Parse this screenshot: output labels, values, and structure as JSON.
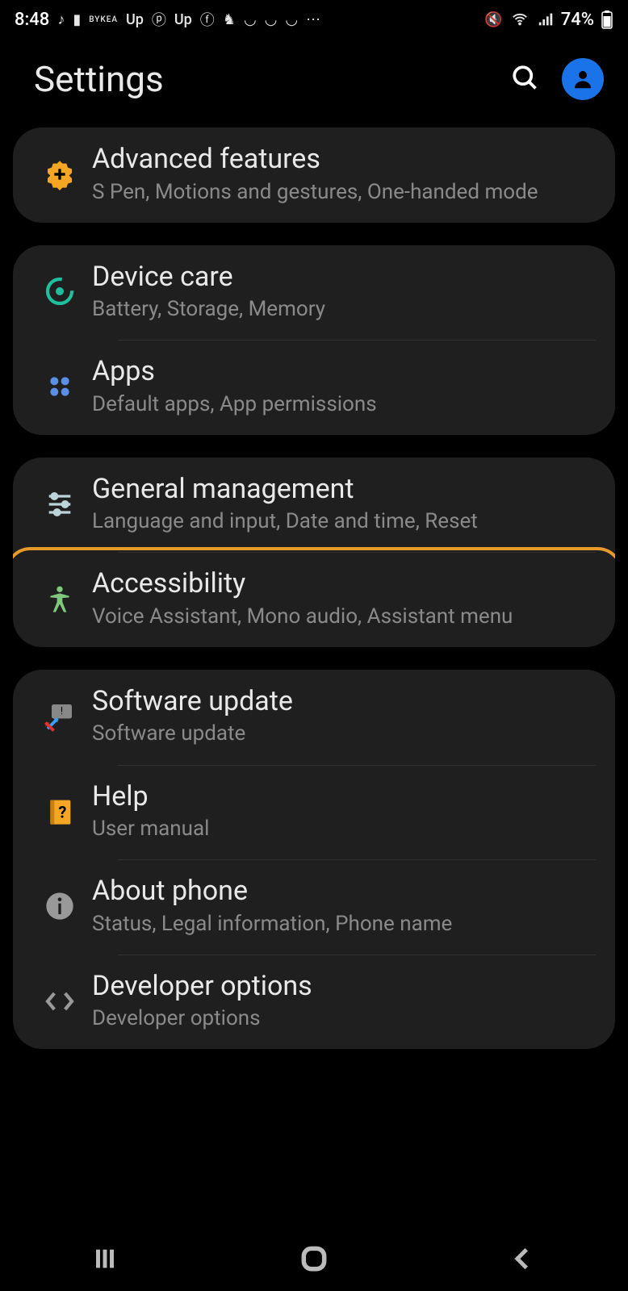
{
  "status_bar": {
    "time": "8:48",
    "battery": "74%",
    "icons_left": [
      "music-note",
      "message",
      "bykea",
      "upwork",
      "pinterest",
      "upwork",
      "facebook",
      "app",
      "smile",
      "smile",
      "smile",
      "more"
    ],
    "icons_right": [
      "mute-vibrate",
      "wifi",
      "signal"
    ]
  },
  "header": {
    "title": "Settings"
  },
  "groups": [
    {
      "items": [
        {
          "key": "advanced",
          "title": "Advanced features",
          "subtitle": "S Pen, Motions and gestures, One-handed mode"
        }
      ]
    },
    {
      "items": [
        {
          "key": "devicecare",
          "title": "Device care",
          "subtitle": "Battery, Storage, Memory"
        },
        {
          "key": "apps",
          "title": "Apps",
          "subtitle": "Default apps, App permissions"
        }
      ]
    },
    {
      "items": [
        {
          "key": "general",
          "title": "General management",
          "subtitle": "Language and input, Date and time, Reset"
        },
        {
          "key": "accessibility",
          "title": "Accessibility",
          "subtitle": "Voice Assistant, Mono audio, Assistant menu",
          "highlighted": true
        }
      ]
    },
    {
      "items": [
        {
          "key": "software",
          "title": "Software update",
          "subtitle": "Software update"
        },
        {
          "key": "help",
          "title": "Help",
          "subtitle": "User manual"
        },
        {
          "key": "about",
          "title": "About phone",
          "subtitle": "Status, Legal information, Phone name"
        },
        {
          "key": "dev",
          "title": "Developer options",
          "subtitle": "Developer options"
        }
      ]
    }
  ]
}
